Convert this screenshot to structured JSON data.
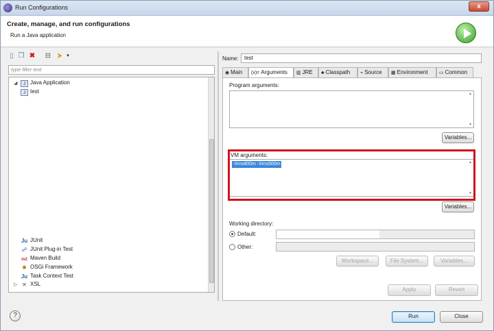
{
  "window": {
    "title": "Run Configurations",
    "close_glyph": "x"
  },
  "header": {
    "title": "Create, manage, and run configurations",
    "subtitle": "Run a Java application",
    "icon": "run-icon"
  },
  "toolbar": {
    "icons": [
      "new-config-icon",
      "duplicate-icon",
      "delete-icon",
      "collapse-icon",
      "filter-icon",
      "dropdown-icon"
    ]
  },
  "filter": {
    "placeholder": "type filter text"
  },
  "tree": {
    "items": [
      {
        "label": "Java Application",
        "icon": "java-app-icon",
        "expanded": true
      },
      {
        "label": "test",
        "icon": "java-config-icon"
      },
      {
        "label": "JUnit",
        "icon": "junit-icon"
      },
      {
        "label": "JUnit Plug-in Test",
        "icon": "junit-plugin-icon"
      },
      {
        "label": "Maven Build",
        "icon": "maven-icon"
      },
      {
        "label": "OSGi Framework",
        "icon": "osgi-icon"
      },
      {
        "label": "Task Context Test",
        "icon": "task-context-icon"
      },
      {
        "label": "XSL",
        "icon": "xsl-icon",
        "expanded": false
      }
    ]
  },
  "config": {
    "name_label": "Name:",
    "name_value": "test",
    "tabs": [
      {
        "label": "Main",
        "icon": "main-tab-icon"
      },
      {
        "label": "Arguments",
        "icon": "arguments-tab-icon",
        "active": true
      },
      {
        "label": "JRE",
        "icon": "jre-tab-icon"
      },
      {
        "label": "Classpath",
        "icon": "classpath-tab-icon"
      },
      {
        "label": "Source",
        "icon": "source-tab-icon"
      },
      {
        "label": "Environment",
        "icon": "environment-tab-icon"
      },
      {
        "label": "Common",
        "icon": "common-tab-icon"
      }
    ],
    "program_args_label": "Program arguments:",
    "program_args_value": "",
    "variables_label_1": "Variables...",
    "vm_args_label": "VM arguments:",
    "vm_args_value": "-Xmx800m -Xms500m",
    "variables_label_2": "Variables...",
    "working_dir_label": "Working directory:",
    "default_label": "Default:",
    "default_value": "",
    "other_label": "Other:",
    "other_value": "",
    "workspace_label": "Workspace...",
    "filesystem_label": "File System...",
    "variables_label_3": "Variables...",
    "apply_label": "Apply",
    "revert_label": "Revert"
  },
  "footer": {
    "help_glyph": "?",
    "run_label": "Run",
    "close_label": "Close"
  },
  "colors": {
    "highlight_box": "#d0121d",
    "selection": "#3b87d9"
  }
}
